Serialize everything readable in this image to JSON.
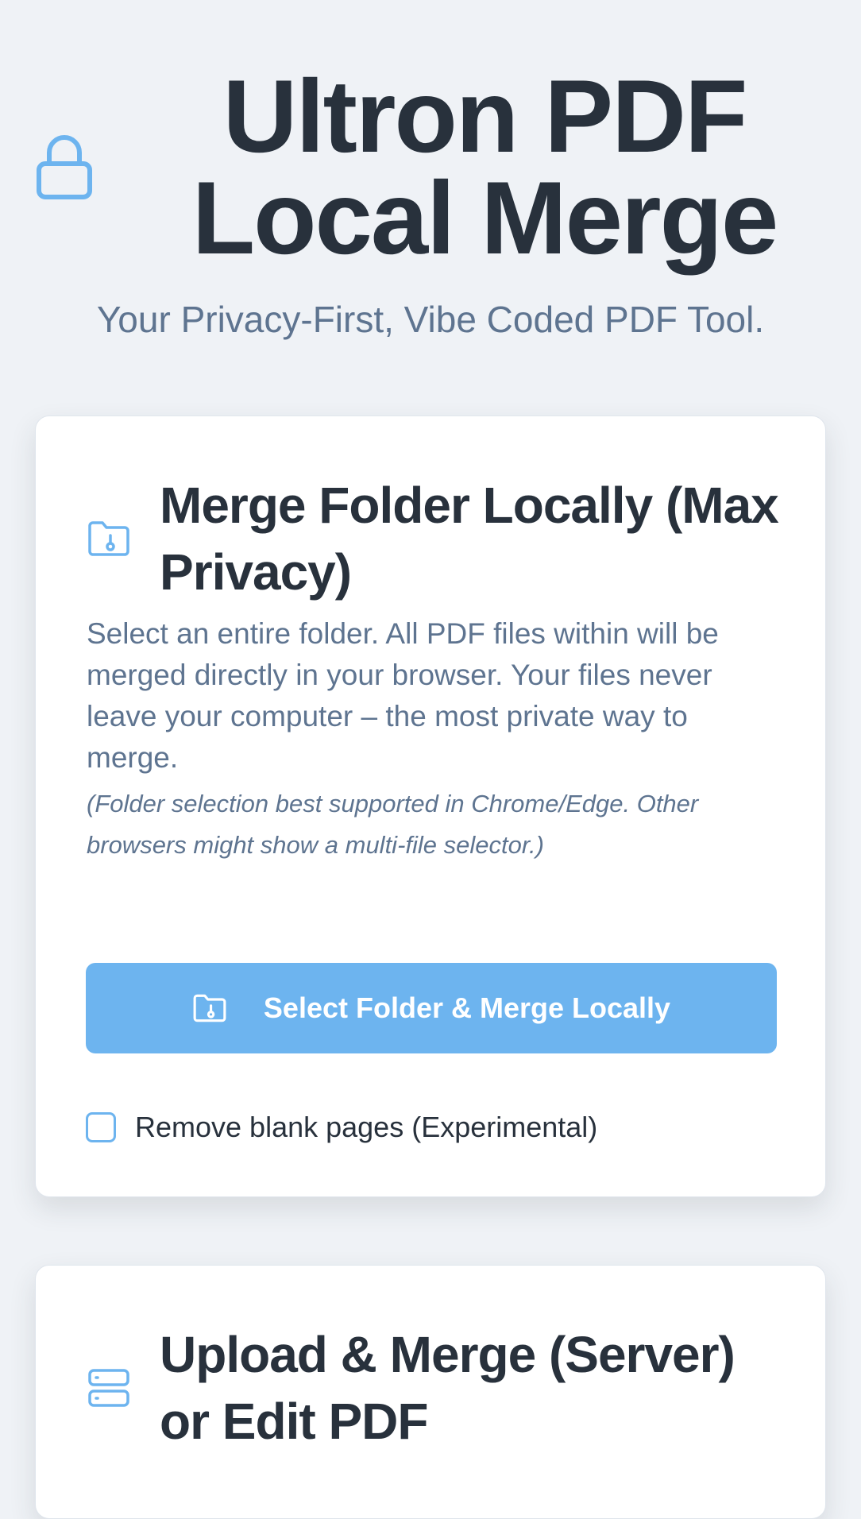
{
  "header": {
    "title": "Ultron PDF Local Merge",
    "subtitle": "Your Privacy-First, Vibe Coded PDF Tool.",
    "icon": "lock-icon"
  },
  "local_card": {
    "icon": "folder-lock-icon",
    "title": "Merge Folder Locally (Max Privacy)",
    "description": "Select an entire folder. All PDF files within will be merged directly in your browser. Your files never leave your computer – the most private way to merge.",
    "note": "(Folder selection best supported in Chrome/Edge. Other browsers might show a multi-file selector.)",
    "button_label": "Select Folder & Merge Locally",
    "button_icon": "folder-lock-icon",
    "checkbox_label": "Remove blank pages (Experimental)",
    "checkbox_checked": false
  },
  "server_card": {
    "icon": "server-icon",
    "title": "Upload & Merge (Server) or Edit PDF"
  },
  "colors": {
    "background": "#eff2f6",
    "accent": "#6db4ef",
    "title_text": "#28313c",
    "muted_text": "#5e7490",
    "card_background": "#ffffff"
  }
}
